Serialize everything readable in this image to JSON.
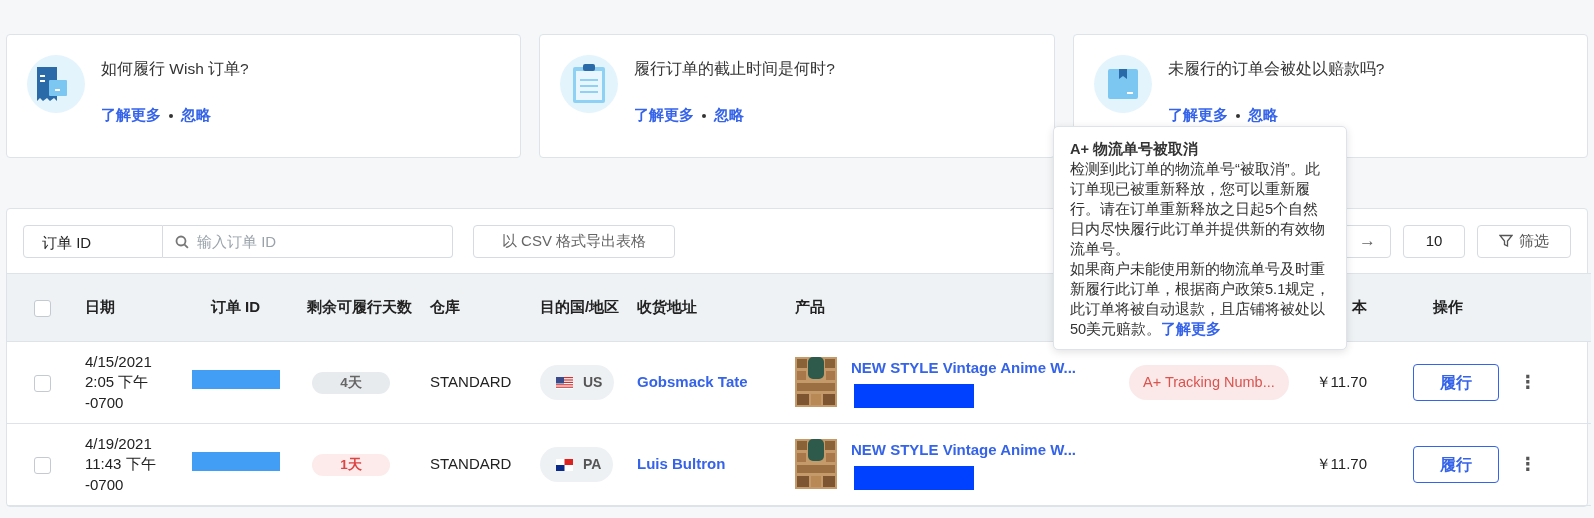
{
  "cards": [
    {
      "kind": "receipt",
      "question": "如何履行 Wish 订单?",
      "links": [
        "了解更多",
        "忽略"
      ]
    },
    {
      "kind": "clipboard",
      "question": "履行订单的截止时间是何时?",
      "links": [
        "了解更多",
        "忽略"
      ]
    },
    {
      "kind": "box",
      "question": "未履行的订单会被处以赔款吗?",
      "links": [
        "了解更多",
        "忽略"
      ]
    }
  ],
  "toolbar": {
    "search_type": "订单 ID",
    "search_placeholder": "输入订单 ID",
    "export_button": "以 CSV 格式导出表格",
    "next_button": "→",
    "page_size": "10",
    "filter_button": "筛选"
  },
  "table": {
    "select_all_checked": false,
    "columns": [
      "日期",
      "订单 ID",
      "剩余可履行天数",
      "仓库",
      "目的国/地区",
      "收货地址",
      "产品",
      "本",
      "操作"
    ],
    "rows": [
      {
        "checked": false,
        "date": [
          "4/15/2021",
          "2:05 下午",
          "-0700"
        ],
        "days": "4天",
        "urgent": false,
        "warehouse": "STANDARD",
        "country": {
          "kind": "us",
          "code": "US"
        },
        "address": "Gobsmack Tate",
        "product": "NEW STYLE Vintage Anime W...",
        "status": "A+ Tracking Numb...",
        "cost": "￥11.70",
        "action": "履行",
        "more": "⋮"
      },
      {
        "checked": false,
        "date": [
          "4/19/2021",
          "11:43 下午",
          "-0700"
        ],
        "days": "1天",
        "urgent": true,
        "warehouse": "STANDARD",
        "country": {
          "kind": "pa",
          "code": "PA"
        },
        "address": "Luis Bultron",
        "product": "NEW STYLE Vintage Anime W...",
        "cost": "￥11.70",
        "action": "履行",
        "more": "⋮"
      }
    ]
  },
  "tooltip": {
    "title": "A+ 物流单号被取消",
    "paragraphs": [
      "检测到此订单的物流单号“被取消”。此订单现已被重新释放，您可以重新履行。请在订单重新释放之日起5个自然日内尽快履行此订单并提供新的有效物流单号。",
      "如果商户未能使用新的物流单号及时重新履行此订单，根据商户政策5.1规定，此订单将被自动退款，且店铺将被处以50美元赔款。"
    ],
    "link": "了解更多"
  }
}
